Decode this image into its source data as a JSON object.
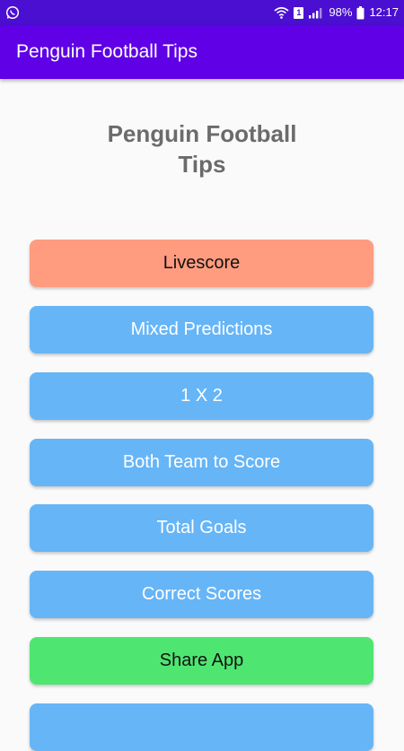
{
  "status_bar": {
    "battery_percent": "98%",
    "time": "12:17",
    "sim_slot": "1",
    "icons": [
      "whatsapp-icon",
      "wifi-icon",
      "sim-icon",
      "signal-icon",
      "battery-icon"
    ]
  },
  "app_bar": {
    "title": "Penguin Football Tips",
    "color": "#5f00e6"
  },
  "main": {
    "heading": "Penguin Football Tips",
    "buttons": [
      {
        "label": "Livescore",
        "color": "#ff9c80"
      },
      {
        "label": "Mixed Predictions",
        "color": "#66b5f7"
      },
      {
        "label": "1 X 2",
        "color": "#66b5f7"
      },
      {
        "label": "Both Team to Score",
        "color": "#66b5f7"
      },
      {
        "label": "Total Goals",
        "color": "#66b5f7"
      },
      {
        "label": "Correct Scores",
        "color": "#66b5f7"
      },
      {
        "label": "Share App",
        "color": "#4ee671"
      },
      {
        "label": "",
        "color": "#66b5f7"
      }
    ]
  },
  "colors": {
    "status_bar": "#4a0fd1",
    "background": "#fafafa",
    "heading_text": "#6b6b6b"
  }
}
